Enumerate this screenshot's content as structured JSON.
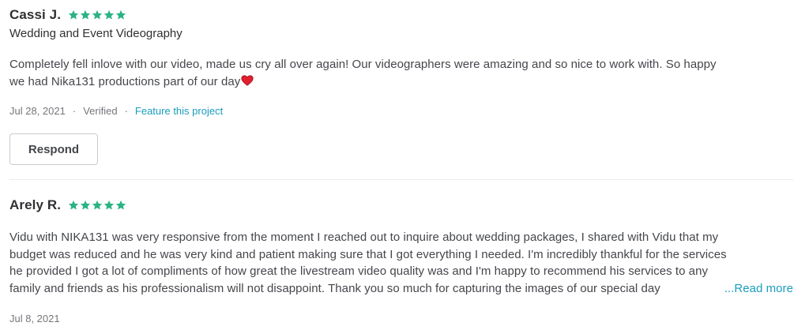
{
  "reviews": [
    {
      "name": "Cassi J.",
      "rating": 5,
      "service": "Wedding and Event Videography",
      "text_line1": "Completely fell inlove with our video, made us cry all over again! Our videographers were amazing and so nice to work with. So happy",
      "text_line2": "we had Nika131 productions part of our day",
      "date": "Jul 28, 2021",
      "verified_label": "Verified",
      "feature_link": "Feature this project",
      "respond_label": "Respond"
    },
    {
      "name": "Arely R.",
      "rating": 5,
      "text_line1": "Vidu with NIKA131 was very responsive from the moment I reached out to inquire about wedding packages, I shared with Vidu that my",
      "text_line2": "budget was reduced and he was very kind and patient making sure that I got everything I needed. I'm incredibly thankful for the services",
      "text_line3": "he provided I got a lot of compliments of how great the livestream video quality was and I'm happy to recommend his services to any",
      "text_line4": "family and friends as his professionalism will not disappoint. Thank you so much for capturing the images of our special day",
      "read_more": "...Read more",
      "date": "Jul 8, 2021"
    }
  ],
  "colors": {
    "star": "#2bb383",
    "link": "#1a9dbd",
    "heart": "#e0202f"
  },
  "icons": {
    "star": "star-icon",
    "heart": "heart-emoji-icon"
  }
}
